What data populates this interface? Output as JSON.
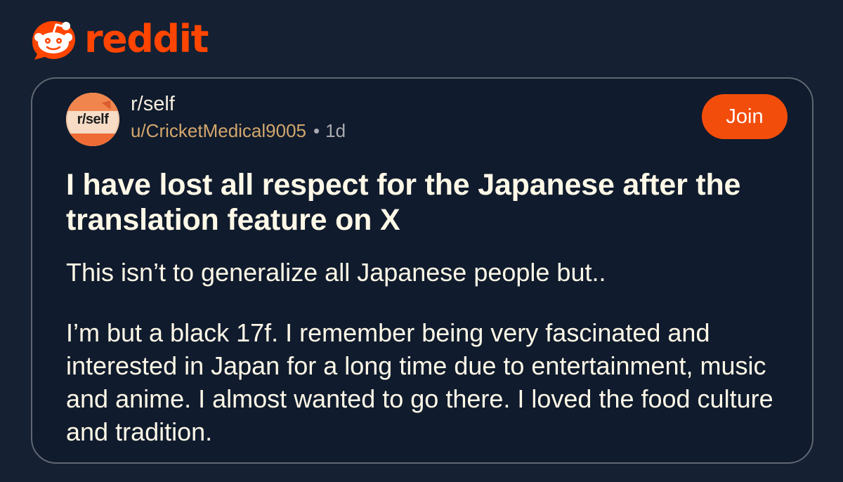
{
  "brand": {
    "name": "reddit",
    "icon": "reddit-alien-icon",
    "color": "#ff4500"
  },
  "post": {
    "avatar_text": "r/self",
    "subreddit": "r/self",
    "username": "u/CricketMedical9005",
    "separator": "•",
    "time_ago": "1d",
    "join_label": "Join",
    "title": "I have lost all respect for the Japanese after the translation feature on X",
    "intro": "This isn’t to generalize all Japanese people but..",
    "body": "I’m but a black 17f. I remember being very fascinated and interested in Japan for a long time due to entertainment, music and anime. I almost wanted to go there. I loved the food culture and tradition."
  },
  "colors": {
    "background": "#152033",
    "accent": "#f34d0c",
    "username": "#d3a76d",
    "text": "#fff8e7"
  }
}
